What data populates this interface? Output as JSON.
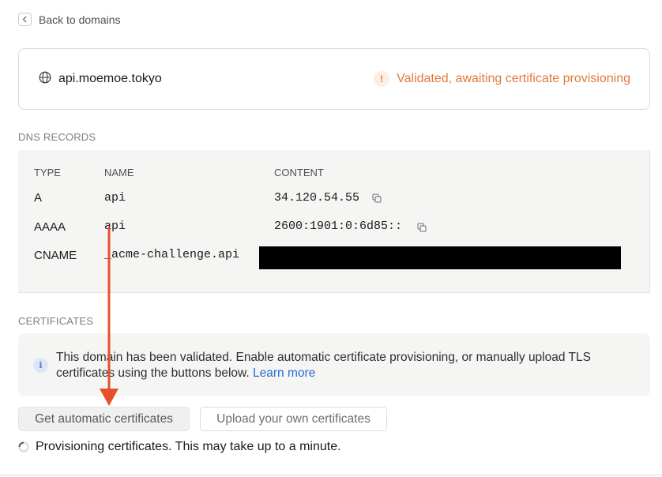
{
  "back": {
    "label": "Back to domains"
  },
  "domain": {
    "name": "api.moemoe.tokyo",
    "status": "Validated, awaiting certificate provisioning",
    "status_color": "#e07a3a"
  },
  "dns": {
    "section_label": "DNS RECORDS",
    "headers": {
      "type": "TYPE",
      "name": "NAME",
      "content": "CONTENT"
    },
    "rows": [
      {
        "type": "A",
        "name": "api",
        "content": "34.120.54.55"
      },
      {
        "type": "AAAA",
        "name": "api",
        "content": "2600:1901:0:6d85::"
      },
      {
        "type": "CNAME",
        "name": "_acme-challenge.api",
        "content": ""
      }
    ]
  },
  "certificates": {
    "section_label": "CERTIFICATES",
    "info_text": "This domain has been validated. Enable automatic certificate provisioning, or manually upload TLS certificates using the buttons below.",
    "learn_more": "Learn more",
    "auto_button": "Get automatic certificates",
    "upload_button": "Upload your own certificates",
    "progress_text": "Provisioning certificates. This may take up to a minute."
  },
  "colors": {
    "accent_link": "#2a6bd2",
    "annotation_arrow": "#e8502b"
  },
  "icons": {
    "back": "chevron-left-icon",
    "domain": "globe-icon",
    "status": "exclamation-icon",
    "copy": "copy-icon",
    "info": "info-icon",
    "progress": "spinner-icon"
  }
}
